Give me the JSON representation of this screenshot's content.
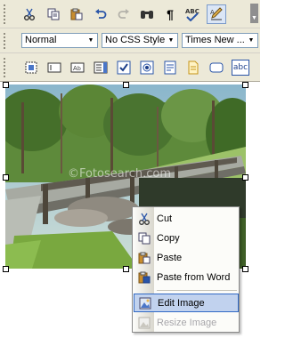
{
  "toolbar1": {
    "buttons": [
      "cut-icon",
      "copy-icon",
      "paste-icon",
      "undo-icon",
      "redo-icon",
      "find-icon",
      "paragraph-icon",
      "spellcheck-icon",
      "edit-icon"
    ]
  },
  "toolbar2": {
    "paragraph_style": "Normal",
    "css_style": "No CSS Style",
    "font_name": "Times New ..."
  },
  "toolbar3": {
    "controls": [
      "div-icon",
      "textbox-icon",
      "label-icon",
      "listbox-icon",
      "checkbox-icon",
      "radio-icon",
      "form-icon",
      "file-icon",
      "button-icon",
      "text-field-icon"
    ],
    "text_field_glyph": "abc"
  },
  "photo": {
    "watermark": "©Fotosearch.com"
  },
  "context_menu": {
    "items": [
      {
        "label": "Cut",
        "icon": "cut-icon",
        "enabled": true
      },
      {
        "label": "Copy",
        "icon": "copy-icon",
        "enabled": true
      },
      {
        "label": "Paste",
        "icon": "paste-icon",
        "enabled": true
      },
      {
        "label": "Paste from Word",
        "icon": "paste-word-icon",
        "enabled": true
      },
      {
        "label": "Edit Image",
        "icon": "edit-image-icon",
        "enabled": true,
        "highlighted": true
      },
      {
        "label": "Resize Image",
        "icon": "resize-image-icon",
        "enabled": false
      }
    ]
  },
  "colors": {
    "toolbar_bg": "#ece9d8",
    "menu_highlight": "#c1d2ee",
    "menu_highlight_border": "#316ac5",
    "disabled_text": "#a7a6aa"
  }
}
